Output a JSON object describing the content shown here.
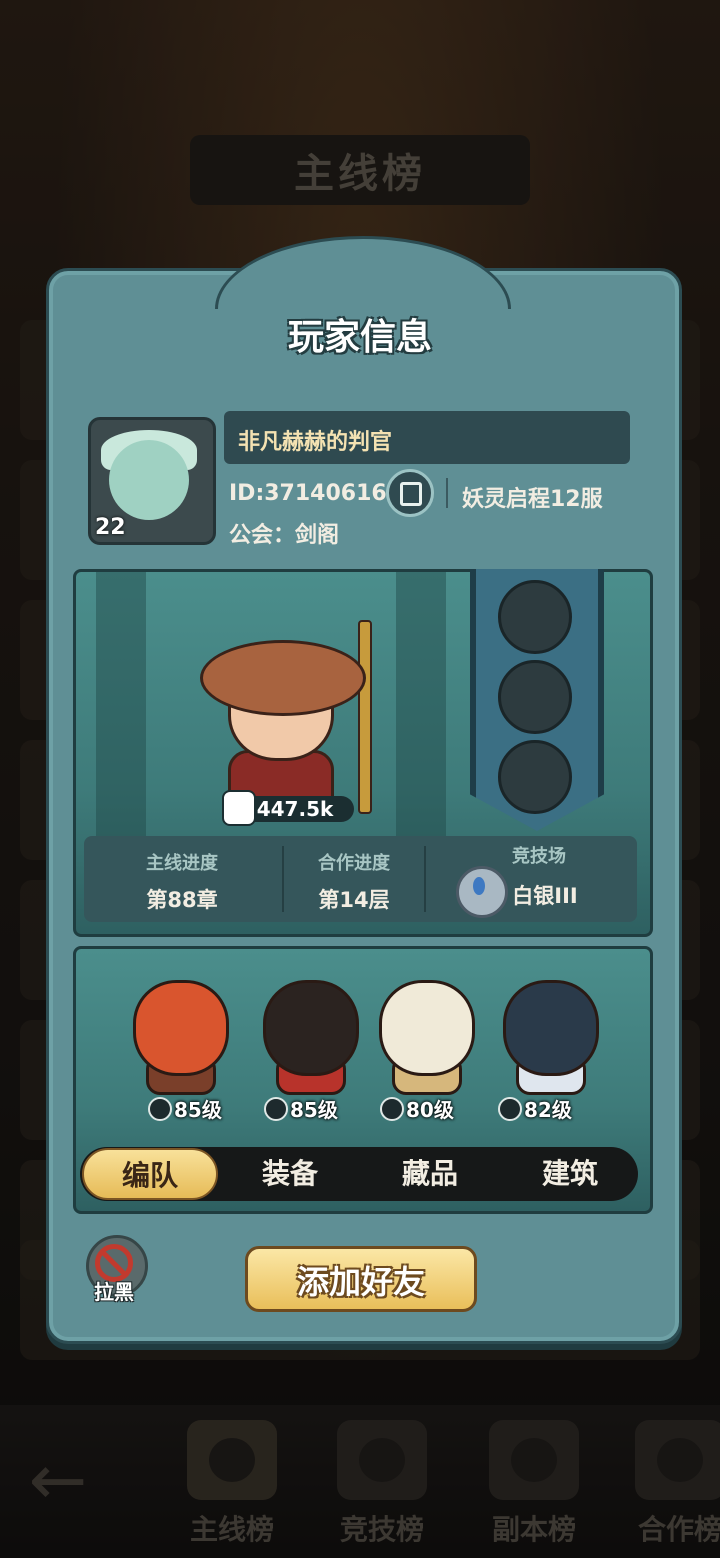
{
  "background": {
    "board_title": "主线榜",
    "nav": [
      {
        "label": "主线榜",
        "icon": "crown-chest-icon"
      },
      {
        "label": "竞技榜",
        "icon": "crossed-swords-icon"
      },
      {
        "label": "副本榜",
        "icon": "portal-icon"
      },
      {
        "label": "合作榜",
        "icon": "handshake-icon"
      }
    ]
  },
  "dialog": {
    "title": "玩家信息"
  },
  "player": {
    "name": "非凡赫赫的判官",
    "id": "ID:37140616",
    "server": "妖灵启程12服",
    "guild": "公会：剑阁",
    "level": "22"
  },
  "showcase": {
    "power": "447.5k",
    "stats": [
      {
        "label": "主线进度",
        "value": "第88章"
      },
      {
        "label": "合作进度",
        "value": "第14层"
      },
      {
        "label": "竞技场",
        "value": "白银III"
      }
    ]
  },
  "team": {
    "members": [
      {
        "level": "85级",
        "class_icon": "sword-class-icon",
        "color": "#d9552e"
      },
      {
        "level": "85级",
        "class_icon": "archer-class-icon",
        "color": "#2b2320"
      },
      {
        "level": "80级",
        "class_icon": "healer-class-icon",
        "color": "#f0ead8"
      },
      {
        "level": "82级",
        "class_icon": "mage-class-icon",
        "color": "#2a3a4a"
      }
    ],
    "tabs": [
      "编队",
      "装备",
      "藏品",
      "建筑"
    ],
    "active_tab": "编队"
  },
  "actions": {
    "block_label": "拉黑",
    "add_friend_label": "添加好友"
  },
  "colors": {
    "panel": "#5f8f95",
    "accent_gold": "#e9bf5a",
    "name_text": "#f4e2b2"
  }
}
